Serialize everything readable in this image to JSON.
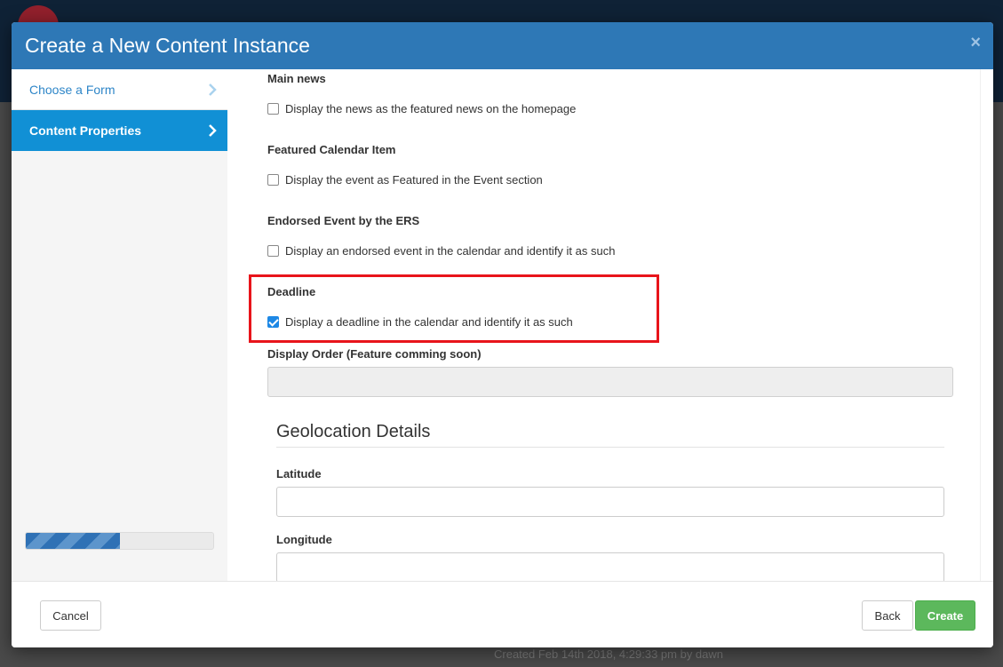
{
  "background": {
    "footnote": "Created Feb 14th 2018, 4:29:33 pm by dawn"
  },
  "modal": {
    "title": "Create a New Content Instance",
    "close_label": "×"
  },
  "sidebar": {
    "items": [
      {
        "label": "Choose a Form",
        "active": false
      },
      {
        "label": "Content Properties",
        "active": true
      }
    ],
    "progress_fraction": 0.5
  },
  "form": {
    "main_news": {
      "label": "Main news",
      "checkbox_label": "Display the news as the featured news on the homepage",
      "checked": false
    },
    "featured_calendar": {
      "label": "Featured Calendar Item",
      "checkbox_label": "Display the event as Featured in the Event section",
      "checked": false
    },
    "endorsed_event": {
      "label": "Endorsed Event by the ERS",
      "checkbox_label": "Display an endorsed event in the calendar and identify it as such",
      "checked": false
    },
    "deadline": {
      "label": "Deadline",
      "checkbox_label": "Display a deadline in the calendar and identify it as such",
      "checked": true
    },
    "display_order": {
      "label": "Display Order (Feature comming soon)",
      "value": ""
    },
    "geolocation": {
      "title": "Geolocation Details",
      "latitude_label": "Latitude",
      "latitude_value": "",
      "longitude_label": "Longitude",
      "longitude_value": ""
    }
  },
  "footer": {
    "cancel_label": "Cancel",
    "back_label": "Back",
    "create_label": "Create"
  },
  "colors": {
    "header": "#2e78b6",
    "sidebar_active": "#1190d5",
    "create_button": "#5cb85c",
    "highlight": "#e8141b"
  }
}
